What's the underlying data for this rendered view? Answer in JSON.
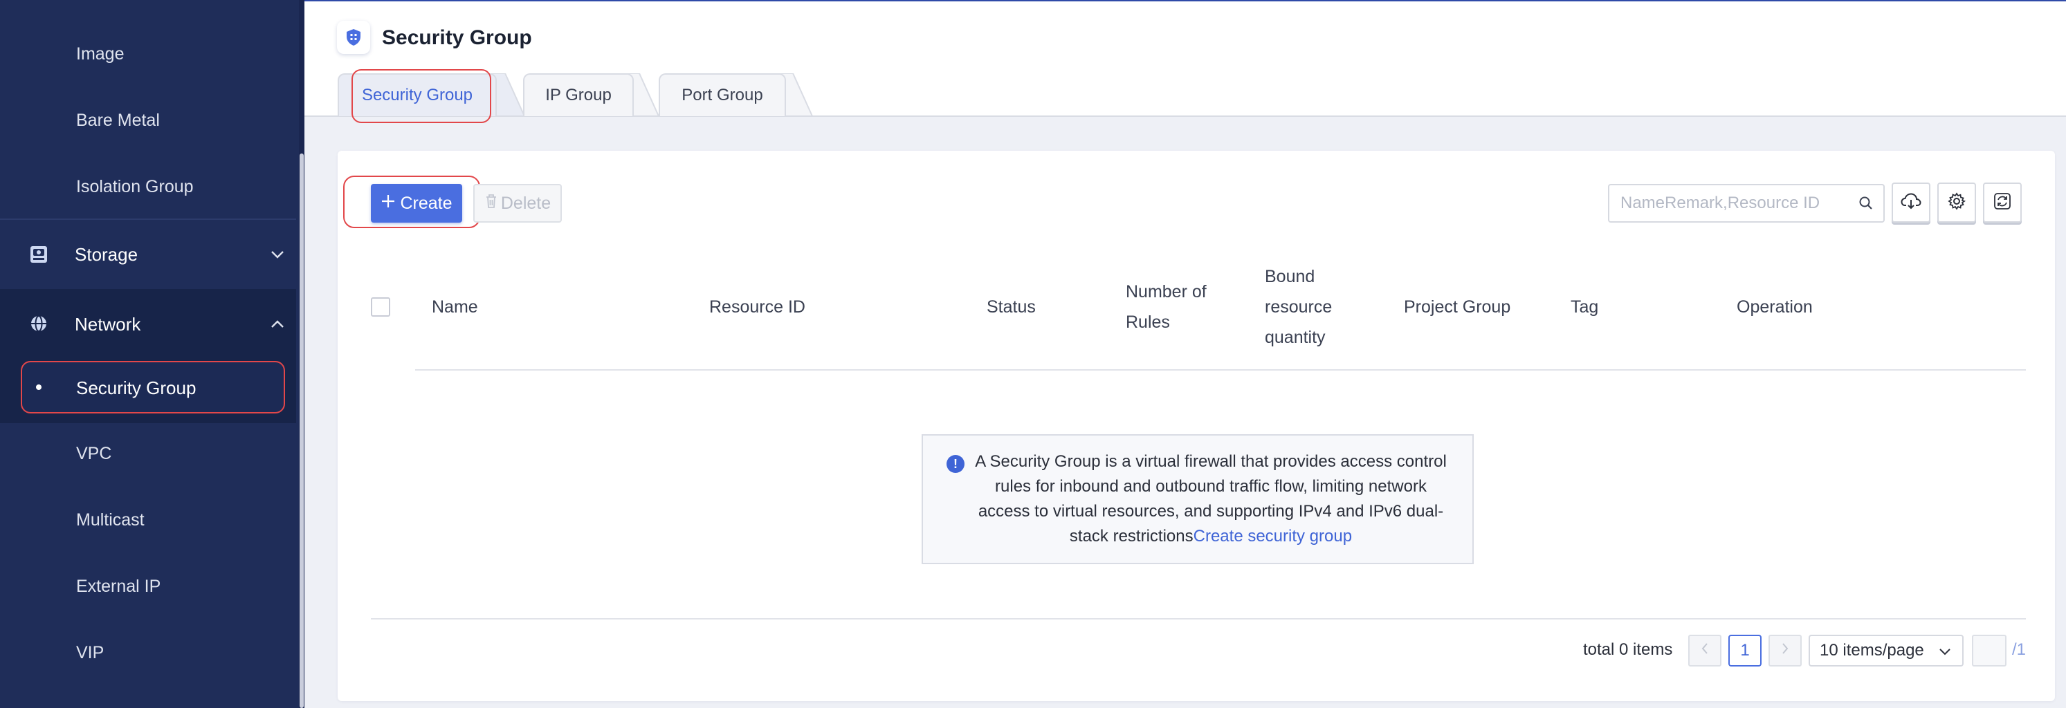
{
  "sidebar": {
    "items_top": [
      "Image",
      "Bare Metal",
      "Isolation Group"
    ],
    "storage": {
      "label": "Storage",
      "icon": "storage-icon"
    },
    "network": {
      "label": "Network",
      "icon": "globe-icon"
    },
    "active": "Security Group",
    "items_bottom": [
      "VPC",
      "Multicast",
      "External IP",
      "VIP"
    ]
  },
  "header": {
    "title": "Security Group",
    "icon": "shield-icon"
  },
  "tabs": [
    {
      "label": "Security Group",
      "active": true
    },
    {
      "label": "IP Group",
      "active": false
    },
    {
      "label": "Port Group",
      "active": false
    }
  ],
  "toolbar": {
    "create_label": "Create",
    "delete_label": "Delete",
    "search_placeholder": "NameRemark,Resource ID"
  },
  "table": {
    "columns": [
      "Name",
      "Resource ID",
      "Status",
      "Number of Rules",
      "Bound resource quantity",
      "Project Group",
      "Tag",
      "Operation"
    ],
    "number_of_rules": [
      "Number of",
      "Rules"
    ],
    "bound_resource": [
      "Bound",
      "resource",
      "quantity"
    ]
  },
  "empty": {
    "message": "A Security Group is a virtual firewall that provides access control rules for inbound and outbound traffic flow, limiting network access to virtual resources, and supporting IPv4 and IPv6 dual-stack restrictions",
    "link": "Create security group"
  },
  "pagination": {
    "total": "total 0 items",
    "current_page": "1",
    "page_size": "10 items/page",
    "total_pages": "/1"
  },
  "colors": {
    "sidebar_bg": "#1f2d59",
    "accent": "#4a6ee0",
    "highlight_border": "#e2474a"
  }
}
